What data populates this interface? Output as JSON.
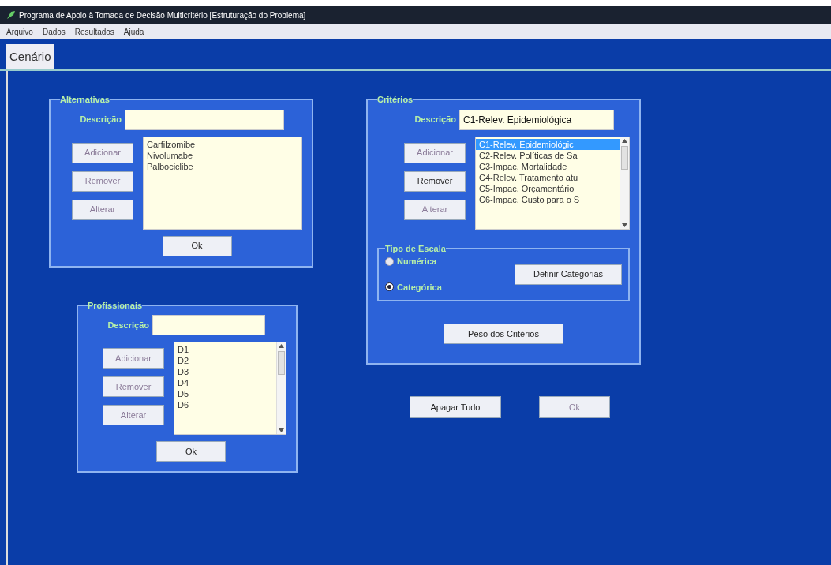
{
  "window": {
    "title": "Programa de Apoio à Tomada de Decisão Multicritério [Estruturação do Problema]"
  },
  "menu": [
    "Arquivo",
    "Dados",
    "Resultados",
    "Ajuda"
  ],
  "tabs": [
    {
      "label": "Cenário",
      "selected": true
    }
  ],
  "alternativas": {
    "title": "Alternativas",
    "label": "Descrição",
    "buttons": [
      {
        "label": "Adicionar",
        "disabled": true
      },
      {
        "label": "Remover",
        "disabled": true
      },
      {
        "label": "Alterar",
        "disabled": true
      }
    ],
    "items": [
      {
        "label": "Carfilzomibe",
        "selected": false
      },
      {
        "label": "Nivolumabe",
        "selected": false
      },
      {
        "label": "Palbociclibe",
        "selected": false
      }
    ],
    "scrollbar": false,
    "ok": "Ok"
  },
  "profissionais": {
    "title": "Profissionais",
    "label": "Descrição",
    "buttons": [
      {
        "label": "Adicionar",
        "disabled": true
      },
      {
        "label": "Remover",
        "disabled": true
      },
      {
        "label": "Alterar",
        "disabled": true
      }
    ],
    "items": [
      {
        "label": "D1",
        "selected": false
      },
      {
        "label": "D2",
        "selected": false
      },
      {
        "label": "D3",
        "selected": false
      },
      {
        "label": "D4",
        "selected": false
      },
      {
        "label": "D5",
        "selected": false
      },
      {
        "label": "D6",
        "selected": false
      }
    ],
    "scrollbar": true,
    "ok": "Ok"
  },
  "criterios": {
    "title": "Critérios",
    "label": "Descrição",
    "value": "C1-Relev. Epidemiológica",
    "buttons": [
      {
        "label": "Adicionar",
        "disabled": true
      },
      {
        "label": "Remover",
        "disabled": false
      },
      {
        "label": "Alterar",
        "disabled": true
      }
    ],
    "items": [
      {
        "label": "C1-Relev. Epidemiológic",
        "selected": true
      },
      {
        "label": "C2-Relev. Políticas de Sa",
        "selected": false
      },
      {
        "label": "C3-Impac. Mortalidade",
        "selected": false
      },
      {
        "label": "C4-Relev. Tratamento atu",
        "selected": false
      },
      {
        "label": "C5-Impac. Orçamentário",
        "selected": false
      },
      {
        "label": "C6-Impac. Custo para o S",
        "selected": false
      }
    ],
    "scrollbar": true,
    "escala": {
      "title": "Tipo de Escala",
      "options": [
        {
          "label": "Numérica",
          "selected": false
        },
        {
          "label": "Categórica",
          "selected": true
        }
      ],
      "button": "Definir Categorias"
    },
    "peso": "Peso dos Critérios"
  },
  "footer": [
    {
      "label": "Apagar Tudo",
      "disabled": false
    },
    {
      "label": "Ok",
      "disabled": true
    }
  ]
}
